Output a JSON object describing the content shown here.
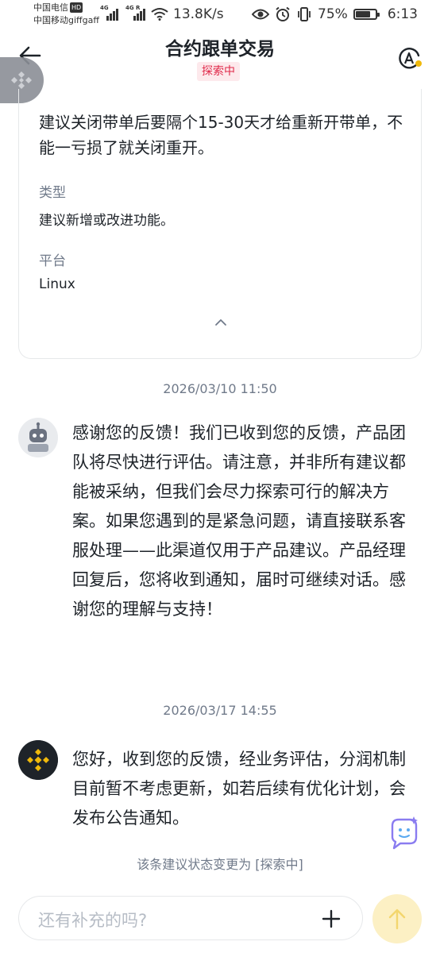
{
  "status_bar": {
    "carrier1": "中国电信",
    "carrier1_badge": "HD",
    "carrier2": "中国移动giffgaff",
    "signal1_label": "4G",
    "signal2_label": "4G R",
    "net_speed": "13.8K/s",
    "battery_percent": "75%",
    "battery_level": 0.75,
    "time": "6:13"
  },
  "header": {
    "title": "合约跟单交易",
    "status_tag": "探索中",
    "back_icon": "arrow-left-icon",
    "translate_icon": "translate-icon"
  },
  "card": {
    "suggestion_text": "建议关闭带单后要隔个15-30天才给重新开带单，不能一亏损了就关闭重开。",
    "type_label": "类型",
    "type_value": "建议新增或改进功能。",
    "platform_label": "平台",
    "platform_value": "Linux"
  },
  "messages": [
    {
      "timestamp": "2026/03/10 11:50",
      "sender": "robot",
      "text": "感谢您的反馈！我们已收到您的反馈，产品团队将尽快进行评估。请注意，并非所有建议都能被采纳，但我们会尽力探索可行的解决方案。如果您遇到的是紧急问题，请直接联系客服处理——此渠道仅用于产品建议。产品经理回复后，您将收到通知，届时可继续对话。感谢您的理解与支持！"
    },
    {
      "timestamp": "2026/03/17 14:55",
      "sender": "binance",
      "text": "您好，收到您的反馈，经业务评估，分润机制目前暂不考虑更新，如若后续有优化计划，会发布公告通知。"
    }
  ],
  "status_change": "该条建议状态变更为 [探索中]",
  "input": {
    "placeholder": "还有补充的吗?"
  },
  "colors": {
    "accent": "#f0b90b",
    "tag_red": "#e0294a",
    "text_secondary": "#707a8a"
  }
}
